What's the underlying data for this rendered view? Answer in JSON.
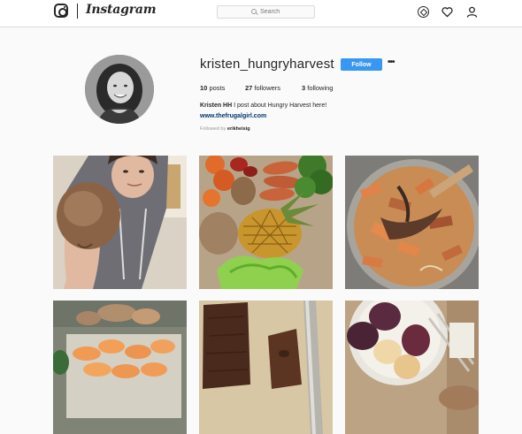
{
  "nav": {
    "logo_word": "Instagram",
    "search_placeholder": "Search"
  },
  "profile": {
    "username": "kristen_hungryharvest",
    "follow_label": "Follow",
    "more_label": "•••",
    "stats": {
      "posts_count": "10",
      "posts_label": "posts",
      "followers_count": "27",
      "followers_label": "followers",
      "following_count": "3",
      "following_label": "following"
    },
    "bio_name": "Kristen HH",
    "bio_text": "I post about Hungry Harvest here!",
    "bio_link": "www.thefrugalgirl.com",
    "followed_by_label": "Followed by",
    "followed_by_user": "erikheisig"
  },
  "colors": {
    "follow_button": "#3897f0",
    "link": "#003569",
    "background": "#fafafa"
  },
  "posts": [
    {
      "subject": "woman holding beet"
    },
    {
      "subject": "vegetables and pineapple"
    },
    {
      "subject": "roasted vegetables in pot"
    },
    {
      "subject": "sweet potato slices"
    },
    {
      "subject": "sliced bread"
    },
    {
      "subject": "plums in bowl"
    }
  ]
}
